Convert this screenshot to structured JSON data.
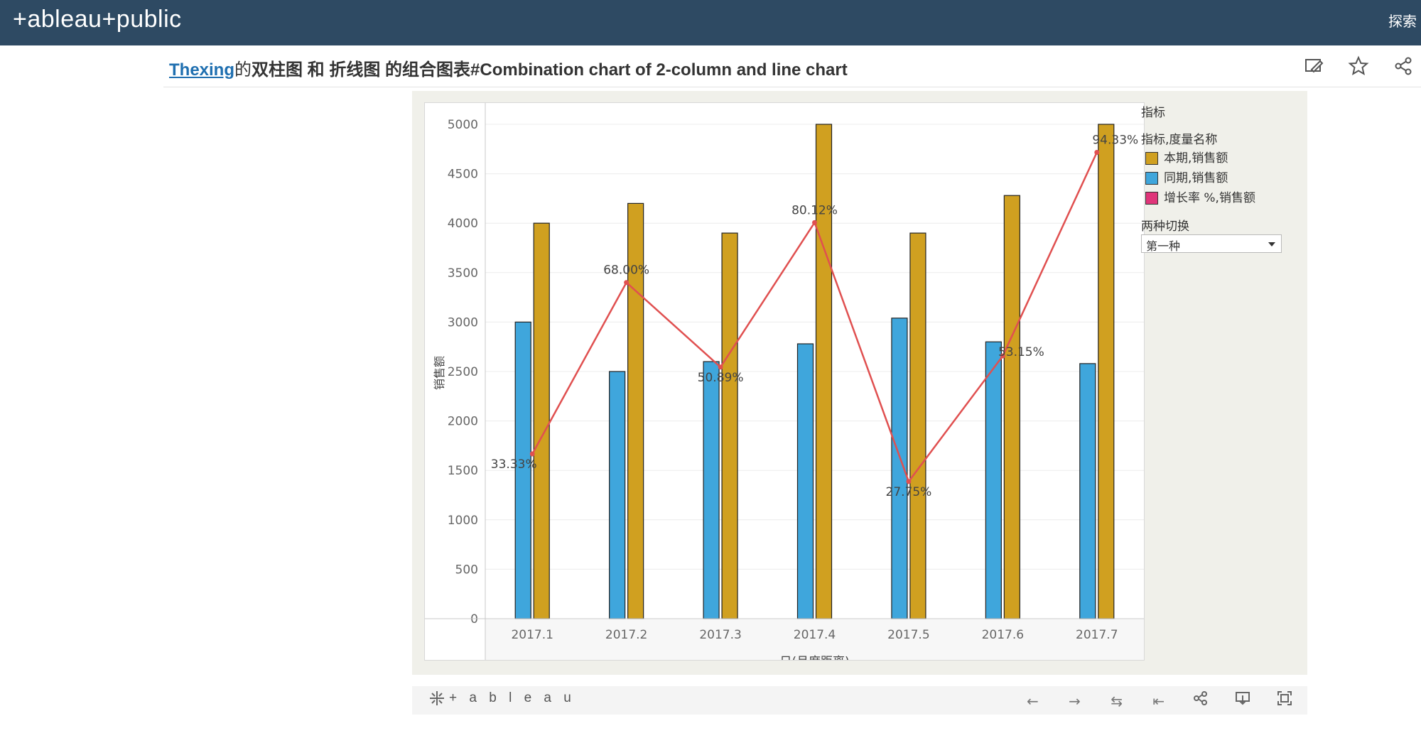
{
  "header": {
    "logo": "+ableau+public",
    "explore": "探索"
  },
  "page": {
    "author": "Thexing",
    "connector": "的",
    "title": "双柱图 和 折线图 的组合图表#Combination chart of 2-column and line chart"
  },
  "legend": {
    "title": "指标",
    "subtitle": "指标,度量名称",
    "items": [
      {
        "label": "本期,销售额",
        "color": "#d0a020"
      },
      {
        "label": "同期,销售额",
        "color": "#3fa6dc"
      },
      {
        "label": "增长率 %,销售额",
        "color": "#e0357a"
      }
    ],
    "control_title": "两种切换",
    "control_value": "第一种"
  },
  "toolbar": {
    "brand": "+ a b l e a u"
  },
  "colors": {
    "current": "#d0a020",
    "prior": "#3fa6dc",
    "line": "#e05050",
    "header": "#2e4a63"
  },
  "chart_data": {
    "type": "bar",
    "categories": [
      "2017.1",
      "2017.2",
      "2017.3",
      "2017.4",
      "2017.5",
      "2017.6",
      "2017.7"
    ],
    "series": [
      {
        "name": "同期,销售额",
        "values": [
          3000,
          2500,
          2600,
          2780,
          3040,
          2800,
          2580
        ]
      },
      {
        "name": "本期,销售额",
        "values": [
          4000,
          4200,
          3900,
          5000,
          3900,
          4280,
          5000
        ]
      }
    ],
    "line_series": {
      "name": "增长率 %,销售额",
      "values": [
        33.33,
        68.0,
        50.89,
        80.12,
        27.75,
        53.15,
        94.33
      ],
      "labels": [
        "33.33%",
        "68.00%",
        "50.89%",
        "80.12%",
        "27.75%",
        "53.15%",
        "94.33%"
      ]
    },
    "xlabel": "日(月度距离)",
    "ylabel": "销售额",
    "ylim": [
      0,
      5000
    ],
    "yticks": [
      0,
      500,
      1000,
      1500,
      2000,
      2500,
      3000,
      3500,
      4000,
      4500,
      5000
    ],
    "grid": true,
    "legend_position": "right"
  }
}
